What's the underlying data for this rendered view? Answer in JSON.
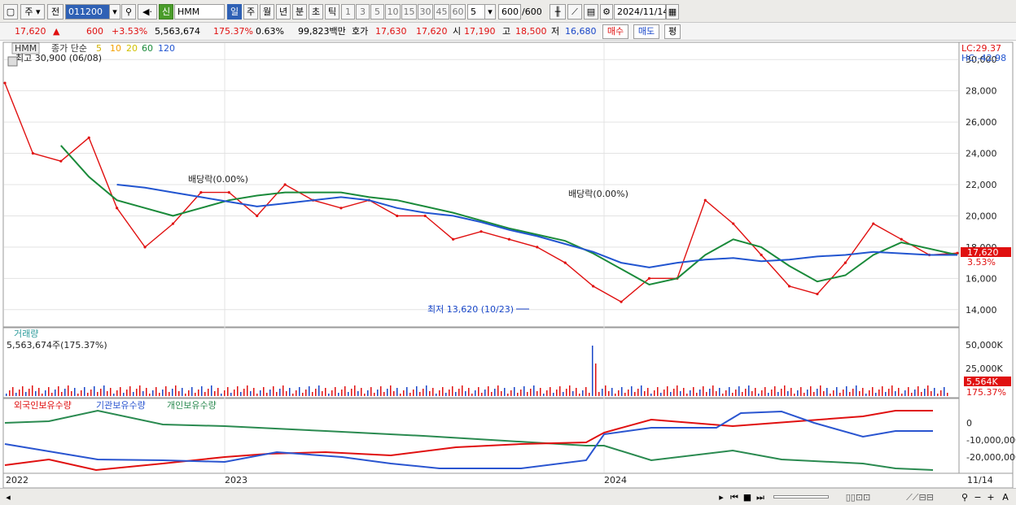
{
  "toolbar": {
    "mode_label": "주",
    "ref_label": "전",
    "code_value": "011200",
    "shin_badge": "신",
    "stock_name": "HMM",
    "period_buttons": [
      "일",
      "주",
      "월",
      "년",
      "분",
      "초",
      "틱"
    ],
    "interval_buttons": [
      "1",
      "3",
      "5",
      "10",
      "15",
      "30",
      "45",
      "60"
    ],
    "interval_custom": "5",
    "count_value": "600",
    "count_total": "/600",
    "date_value": "2024/11/14"
  },
  "quote": {
    "price": "17,620",
    "change": "600",
    "change_pct": "+3.53%",
    "volume": "5,563,674",
    "volume_ratio": "175.37%",
    "turnover": "0.63%",
    "amount": "99,823백만",
    "bid_label": "호가",
    "ask": "17,630",
    "bid": "17,620",
    "open_label": "시",
    "open": "17,190",
    "high_label": "고",
    "high": "18,500",
    "low_label": "저",
    "low": "16,680",
    "buy_button": "매수",
    "sell_button": "매도",
    "avg_button": "평"
  },
  "price_panel": {
    "stock_tag": "HMM",
    "ma_title": "종가 단순",
    "ma_periods": [
      "5",
      "10",
      "20",
      "60",
      "120"
    ],
    "high_note": "최고 30,900 (06/08)",
    "low_note": "최저 13,620 (10/23)",
    "dividend_note": "배당락(0.00%)",
    "lc": "LC:29.37",
    "hc": "HC:-42.98",
    "y_ticks": [
      "30,000",
      "28,000",
      "26,000",
      "24,000",
      "22,000",
      "20,000",
      "18,000",
      "16,000",
      "14,000"
    ],
    "last_price_tag": "17,620",
    "last_pct_tag": "3.53%"
  },
  "volume_panel": {
    "title": "거래량",
    "value_note": "5,563,674주(175.37%)",
    "y_ticks": [
      "50,000K",
      "25,000K"
    ],
    "last_tag": "5,564K",
    "pct_tag": "175.37%"
  },
  "holdings_panel": {
    "series": [
      "외국인보유수량",
      "기관보유수량",
      "개인보유수량"
    ],
    "y_ticks": [
      "0",
      "-10,000,000",
      "-20,000,000"
    ]
  },
  "x_axis": {
    "labels": [
      "2022",
      "2023",
      "2024"
    ],
    "last_date": "11/14"
  },
  "colors": {
    "ma5": "#e8d800",
    "ma10": "#f3a000",
    "ma20": "#e8d800",
    "ma60": "#1a8a3a",
    "ma120": "#2255d0",
    "up": "#e01010",
    "down": "#1846c8",
    "foreign": "#e01010",
    "institution": "#2a55d0",
    "individual": "#2a8a50"
  },
  "chart_data": {
    "type": "line",
    "title": "",
    "x": [
      "2022-01",
      "2022-02",
      "2022-03",
      "2022-04",
      "2022-05",
      "2022-06",
      "2022-07",
      "2022-08",
      "2022-09",
      "2022-10",
      "2022-11",
      "2022-12",
      "2023-01",
      "2023-02",
      "2023-03",
      "2023-04",
      "2023-05",
      "2023-06",
      "2023-07",
      "2023-08",
      "2023-09",
      "2023-10",
      "2023-11",
      "2023-12",
      "2024-01",
      "2024-02",
      "2024-03",
      "2024-04",
      "2024-05",
      "2024-06",
      "2024-07",
      "2024-08",
      "2024-09",
      "2024-10",
      "2024-11"
    ],
    "series": [
      {
        "name": "종가",
        "values": [
          28500,
          24000,
          23500,
          25000,
          20500,
          18000,
          19500,
          21500,
          21500,
          20000,
          22000,
          21000,
          20500,
          21000,
          20000,
          20000,
          18500,
          19000,
          18500,
          18000,
          17000,
          15500,
          14500,
          16000,
          16000,
          21000,
          19500,
          17500,
          15500,
          15000,
          17000,
          19500,
          18500,
          17500,
          17620
        ]
      },
      {
        "name": "60",
        "values": [
          null,
          null,
          24500,
          22500,
          21000,
          20500,
          20000,
          20500,
          21000,
          21300,
          21500,
          21500,
          21500,
          21200,
          21000,
          20600,
          20200,
          19700,
          19200,
          18800,
          18400,
          17600,
          16600,
          15600,
          16000,
          17500,
          18500,
          18000,
          16800,
          15800,
          16200,
          17500,
          18300,
          17900,
          17500
        ]
      },
      {
        "name": "120",
        "values": [
          null,
          null,
          null,
          null,
          22000,
          21800,
          21500,
          21200,
          20900,
          20600,
          20800,
          21000,
          21200,
          21000,
          20500,
          20200,
          20000,
          19600,
          19100,
          18700,
          18200,
          17700,
          17000,
          16700,
          17000,
          17200,
          17300,
          17100,
          17200,
          17400,
          17500,
          17700,
          17600,
          17500,
          17500
        ]
      }
    ],
    "ylim": [
      13000,
      31000
    ],
    "xlabel": "",
    "ylabel": ""
  }
}
